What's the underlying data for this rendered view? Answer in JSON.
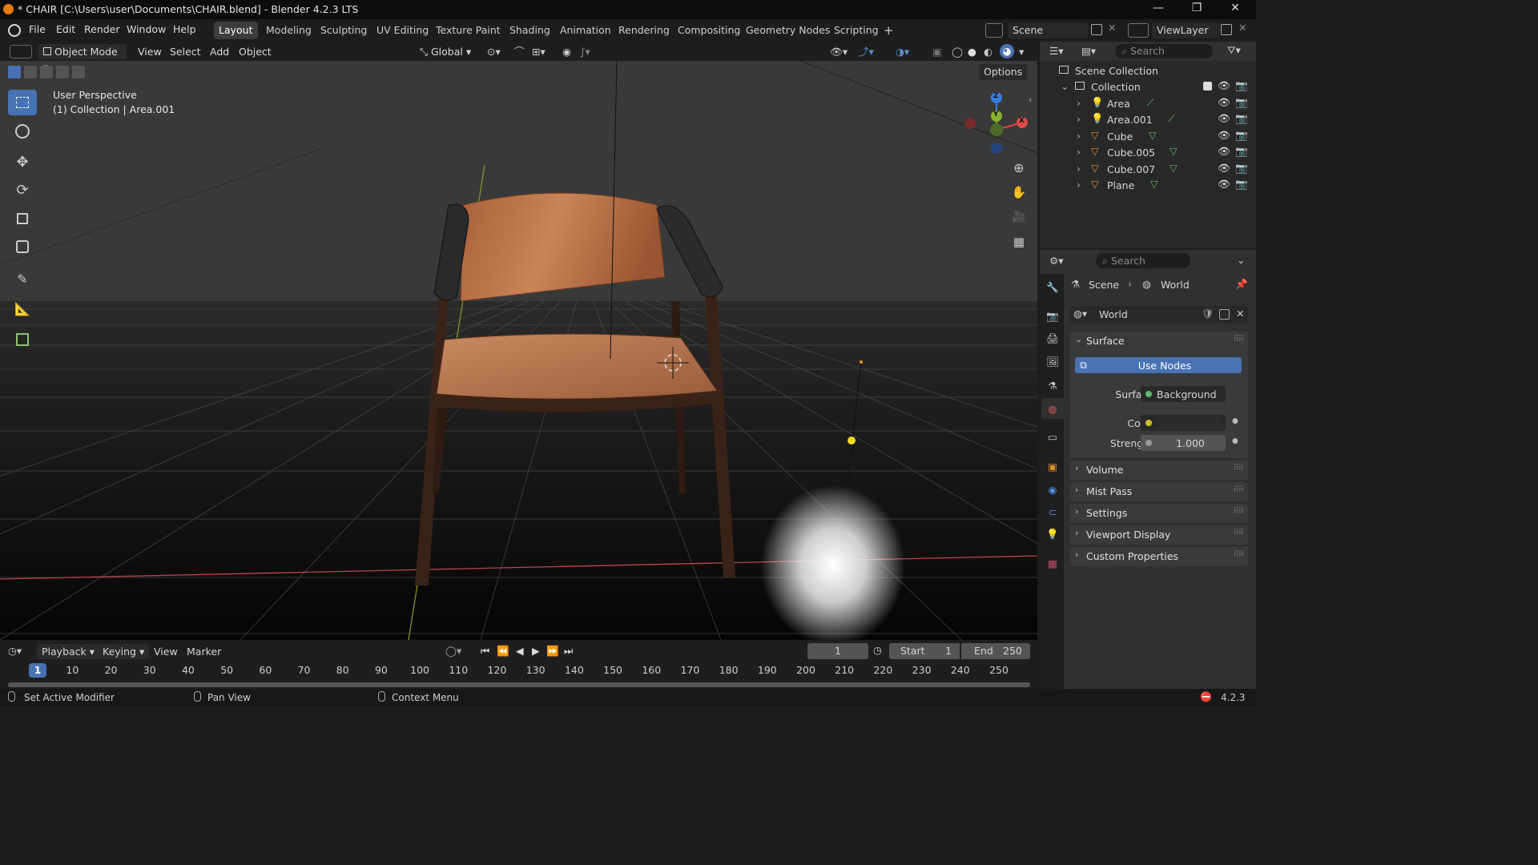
{
  "window": {
    "title": "* CHAIR [C:\\Users\\user\\Documents\\CHAIR.blend] - Blender 4.2.3 LTS",
    "minimize": "—",
    "maximize": "❐",
    "close": "✕"
  },
  "menu": {
    "items": [
      "File",
      "Edit",
      "Render",
      "Window",
      "Help"
    ],
    "workspaces": [
      "Layout",
      "Modeling",
      "Sculpting",
      "UV Editing",
      "Texture Paint",
      "Shading",
      "Animation",
      "Rendering",
      "Compositing",
      "Geometry Nodes",
      "Scripting"
    ],
    "add_workspace": "+",
    "scene": "Scene",
    "view_layer": "ViewLayer"
  },
  "viewport_header": {
    "mode": "Object Mode",
    "menus": [
      "View",
      "Select",
      "Add",
      "Object"
    ],
    "transform_orientation": "Global",
    "options": "Options"
  },
  "viewport": {
    "perspective": "User Perspective",
    "collection_info": "(1) Collection | Area.001",
    "gizmo": {
      "z": "Z",
      "y": "Y",
      "x": "X"
    }
  },
  "outliner": {
    "search_placeholder": "Search",
    "scene_collection": "Scene Collection",
    "collection": "Collection",
    "objects": [
      {
        "name": "Area",
        "type": "light"
      },
      {
        "name": "Area.001",
        "type": "light"
      },
      {
        "name": "Cube",
        "type": "mesh"
      },
      {
        "name": "Cube.005",
        "type": "mesh"
      },
      {
        "name": "Cube.007",
        "type": "mesh"
      },
      {
        "name": "Plane",
        "type": "mesh"
      }
    ]
  },
  "properties": {
    "search_placeholder": "Search",
    "breadcrumb_scene": "Scene",
    "breadcrumb_world": "World",
    "datablock": "World",
    "surface_panel": "Surface",
    "use_nodes": "Use Nodes",
    "surface_label": "Surface",
    "surface_value": "Background",
    "color_label": "Color",
    "strength_label": "Strength",
    "strength_value": "1.000",
    "panels": [
      "Volume",
      "Mist Pass",
      "Settings",
      "Viewport Display",
      "Custom Properties"
    ]
  },
  "timeline": {
    "menus": [
      "Playback",
      "Keying",
      "View",
      "Marker"
    ],
    "current_frame": "1",
    "start_label": "Start",
    "start_value": "1",
    "end_label": "End",
    "end_value": "250",
    "ruler": [
      "1",
      "10",
      "20",
      "30",
      "40",
      "50",
      "60",
      "70",
      "80",
      "90",
      "100",
      "110",
      "120",
      "130",
      "140",
      "150",
      "160",
      "170",
      "180",
      "190",
      "200",
      "210",
      "220",
      "230",
      "240",
      "250"
    ]
  },
  "status": {
    "left": "Set Active Modifier",
    "middle": "Pan View",
    "right": "Context Menu",
    "version": "4.2.3"
  },
  "colors": {
    "accent": "#4772b3",
    "active_tool": "#4772b3",
    "x_axis": "#e04a4a",
    "y_axis": "#86b32b",
    "z_axis": "#3a7ee0",
    "light_dot": "#f5d81a"
  }
}
